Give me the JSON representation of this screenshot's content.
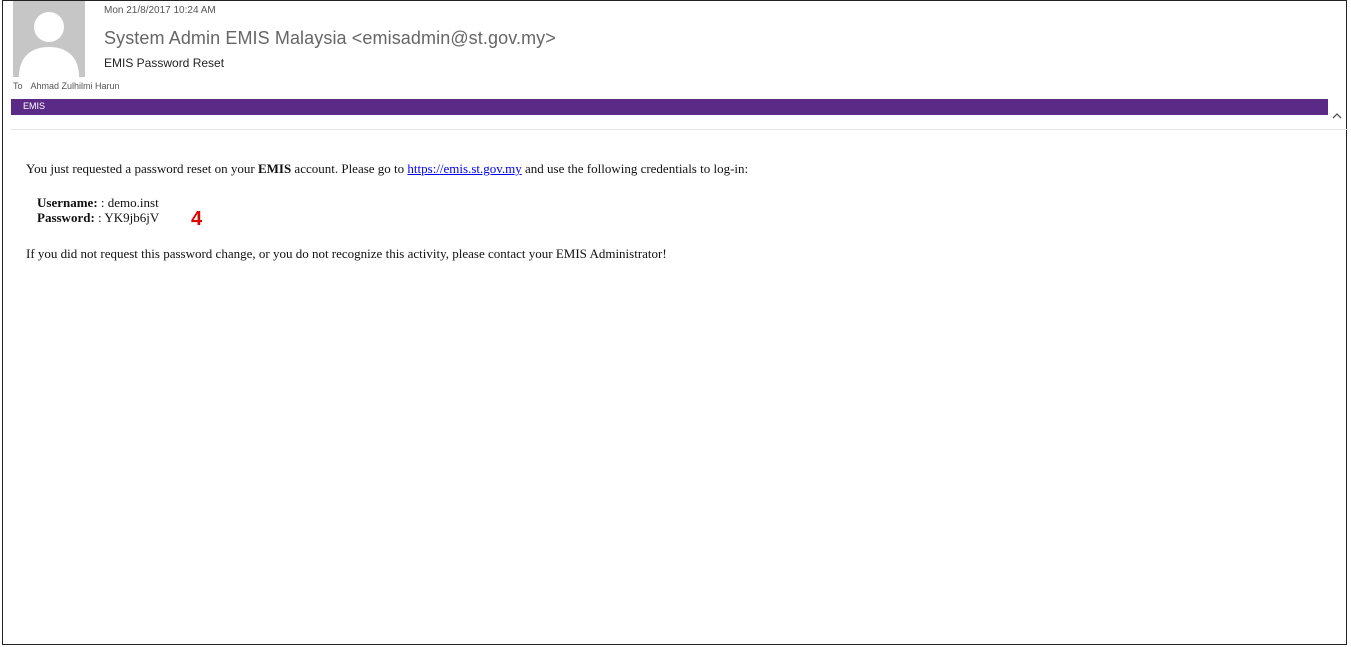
{
  "message": {
    "date": "Mon 21/8/2017 10:24 AM",
    "sender": "System Admin EMIS Malaysia <emisadmin@st.gov.my>",
    "subject": "EMIS Password Reset",
    "to_label": "To",
    "to_name": "Ahmad Zulhilmi Harun",
    "category": "EMIS",
    "category_color": "#5b2a86"
  },
  "body": {
    "intro_before_bold": "You just requested a password reset on your ",
    "intro_bold": "EMIS",
    "intro_after_bold": " account. Please go to ",
    "link_text": "https://emis.st.gov.my",
    "intro_after_link": " and use the following credentials to log-in:",
    "username_label": "Username:",
    "username_value": " : demo.inst",
    "password_label": "Password:",
    "password_value": " : YK9jb6jV",
    "closing": "If you did not request this password change, or you do not recognize this activity, please contact your EMIS Administrator!"
  },
  "annotation": {
    "marker": "4",
    "marker_color": "#e00000"
  },
  "icons": {
    "avatar": "person-silhouette-icon",
    "collapse": "chevron-up-icon"
  }
}
